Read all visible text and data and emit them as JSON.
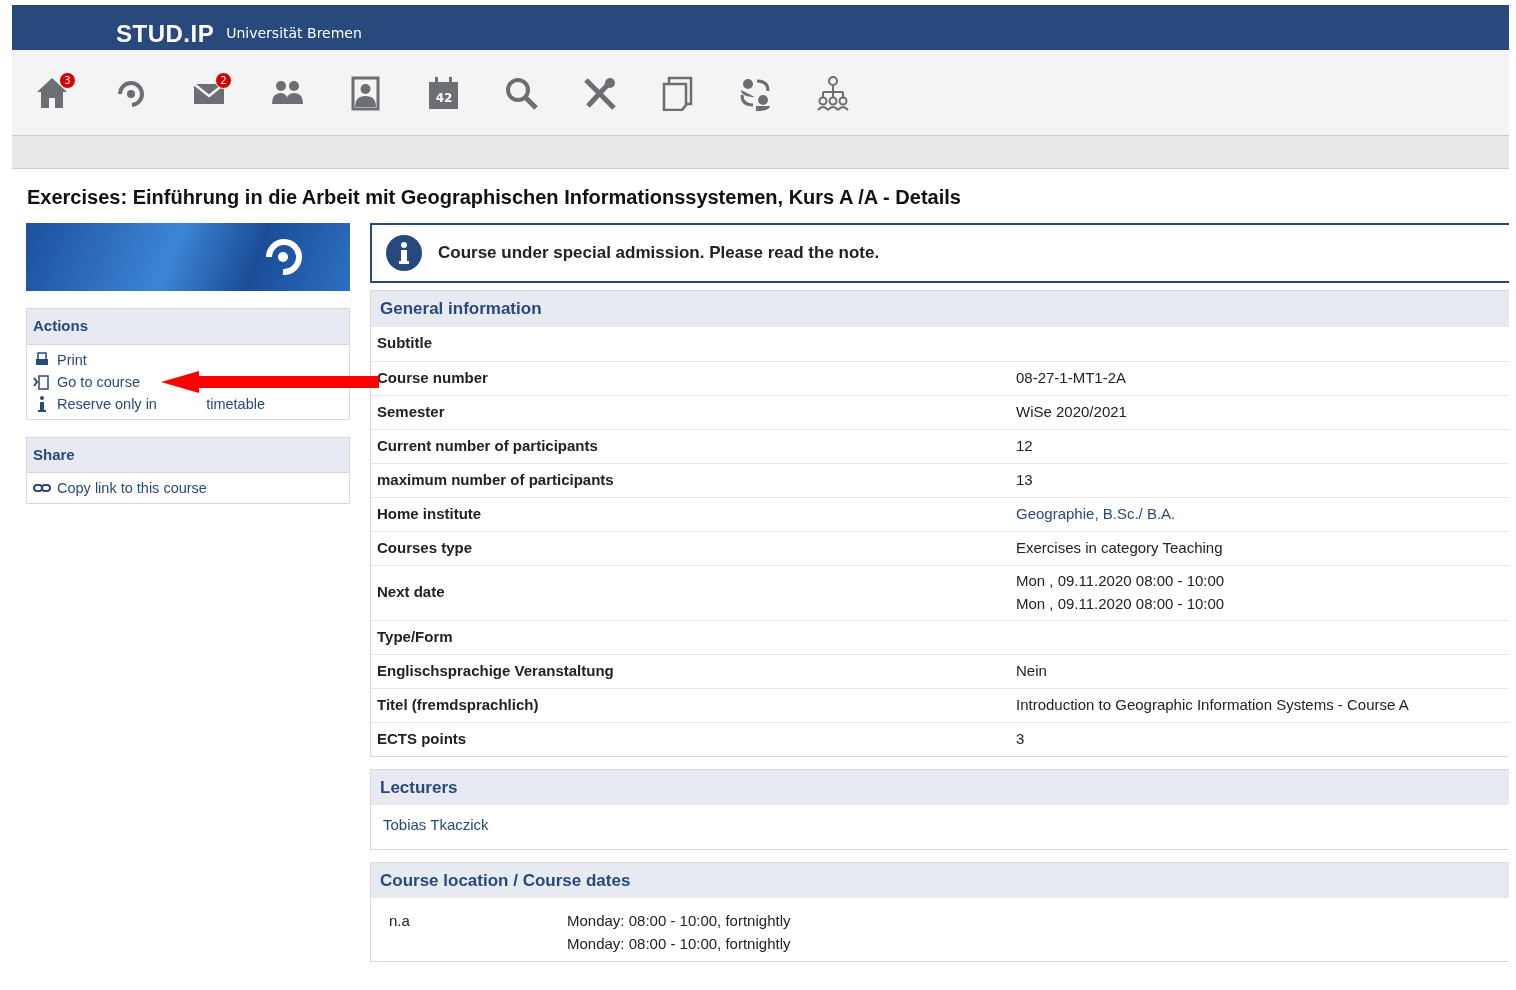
{
  "header": {
    "logo": "STUD.IP",
    "university": "Universität Bremen"
  },
  "nav": {
    "home_badge": "3",
    "mail_badge": "2",
    "calendar_day": "42"
  },
  "page_title": "Exercises: Einführung in die Arbeit mit Geographischen Informationssystemen, Kurs A /A - Details",
  "sidebar": {
    "sections": [
      {
        "title": "Actions",
        "items": [
          {
            "label": "Print"
          },
          {
            "label": "Go to course"
          },
          {
            "label": "Reserve only in",
            "tail": "timetable"
          }
        ]
      },
      {
        "title": "Share",
        "items": [
          {
            "label": "Copy link to this course"
          }
        ]
      }
    ]
  },
  "overlay_arrow": true,
  "notice": "Course under special admission. Please read the note.",
  "general": {
    "title": "General information",
    "rows": [
      {
        "label": "Subtitle"
      },
      {
        "label": "Course number",
        "kind": "text",
        "lines": [
          "08-27-1-MT1-2A"
        ]
      },
      {
        "label": "Semester",
        "kind": "text",
        "lines": [
          "WiSe 2020/2021"
        ]
      },
      {
        "label": "Current number of participants",
        "kind": "text",
        "lines": [
          "12"
        ]
      },
      {
        "label": "maximum number of participants",
        "kind": "text",
        "lines": [
          "13"
        ]
      },
      {
        "label": "Home institute",
        "kind": "link",
        "lines": [
          "Geographie, B.Sc./ B.A."
        ]
      },
      {
        "label": "Courses type",
        "kind": "text",
        "lines": [
          "Exercises in category Teaching"
        ]
      },
      {
        "label": "Next date",
        "kind": "text",
        "lines": [
          "Mon , 09.11.2020 08:00 - 10:00",
          "Mon , 09.11.2020 08:00 - 10:00"
        ]
      },
      {
        "label": "Type/Form"
      },
      {
        "label": "Englischsprachige Veranstaltung",
        "kind": "text",
        "lines": [
          "Nein"
        ]
      },
      {
        "label": "Titel (fremdsprachlich)",
        "kind": "text",
        "lines": [
          "Introduction to Geographic Information Systems - Course A"
        ]
      },
      {
        "label": "ECTS points",
        "kind": "text",
        "lines": [
          "3"
        ]
      }
    ]
  },
  "lecturers": {
    "title": "Lecturers",
    "names": [
      "Tobias Tkaczick"
    ]
  },
  "location": {
    "title": "Course location / Course dates",
    "entries": [
      {
        "room": "n.a",
        "dates": [
          "Monday: 08:00 - 10:00, fortnightly",
          "Monday: 08:00 - 10:00, fortnightly"
        ]
      }
    ]
  }
}
